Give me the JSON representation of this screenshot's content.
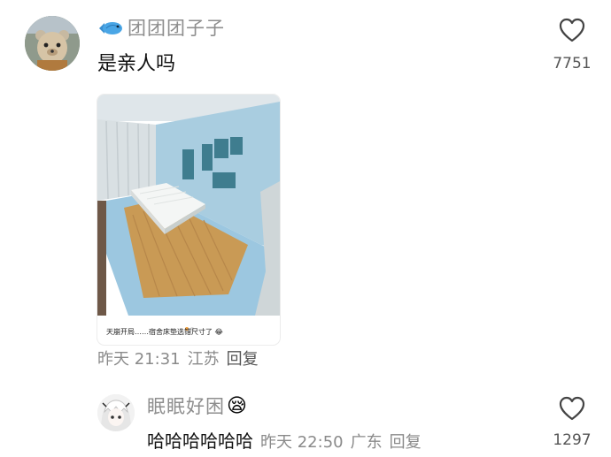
{
  "comment1": {
    "username": "团团团子子",
    "text": "是亲人吗",
    "likes": "7751",
    "time": "昨天 21:31",
    "location": "江苏",
    "reply_label": "回复",
    "image_caption": "天崩开局……宿舍床垫选错尺寸了 😂"
  },
  "comment2": {
    "username": "眠眠好困",
    "emoji": "😪",
    "text": "哈哈哈哈哈哈",
    "time": "昨天 22:50",
    "location": "广东",
    "reply_label": "回复",
    "likes": "1297"
  },
  "colors": {
    "username_gray": "#8e8e8e",
    "text_black": "#111111",
    "meta_gray": "#8a8a8a",
    "curtain_blue": "#a9cde0"
  },
  "icons": [
    "fish-icon",
    "heart-icon",
    "emoji-sleepy-icon"
  ]
}
